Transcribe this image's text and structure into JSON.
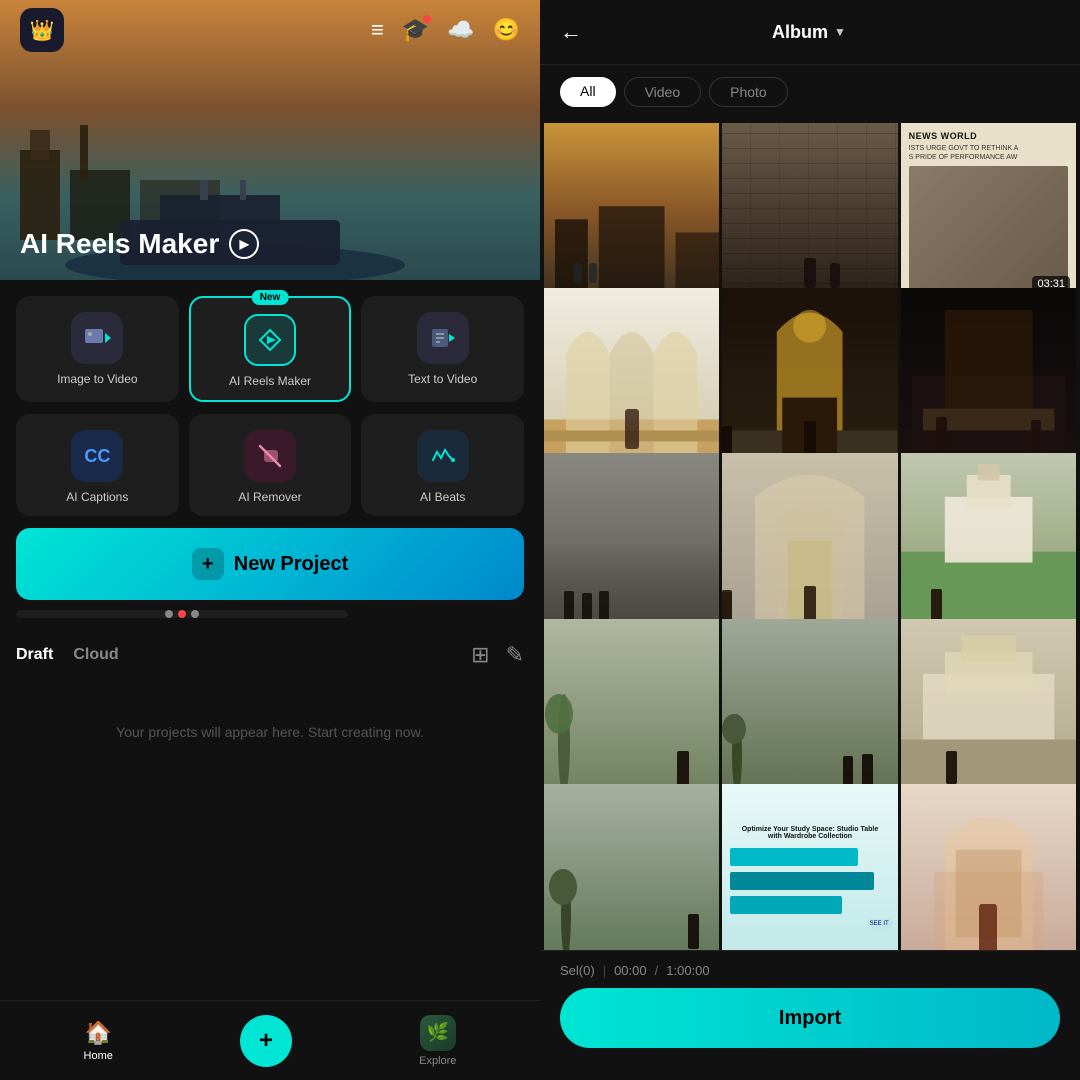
{
  "left": {
    "hero_title": "AI Reels Maker",
    "tools": [
      {
        "id": "image-to-video",
        "label": "Image to Video",
        "icon": "🎬",
        "iconClass": "tool-icon-img",
        "new": false,
        "active": false
      },
      {
        "id": "ai-reels-maker",
        "label": "AI Reels Maker",
        "icon": "⚡",
        "iconClass": "tool-icon-reels",
        "new": true,
        "active": true
      },
      {
        "id": "text-to-video",
        "label": "Text to Video",
        "icon": "✏️",
        "iconClass": "tool-icon-txt",
        "new": false,
        "active": false
      },
      {
        "id": "ai-captions",
        "label": "AI Captions",
        "icon": "CC",
        "iconClass": "tool-icon-cc",
        "new": false,
        "active": false
      },
      {
        "id": "ai-remover",
        "label": "AI Remover",
        "icon": "🧹",
        "iconClass": "tool-icon-remover",
        "new": false,
        "active": false
      },
      {
        "id": "ai-beats",
        "label": "AI Beats",
        "icon": "🎵",
        "iconClass": "tool-icon-beats",
        "new": false,
        "active": false
      }
    ],
    "new_project_label": "New Project",
    "new_badge_label": "New",
    "tabs": [
      "Draft",
      "Cloud"
    ],
    "active_tab": "Draft",
    "empty_state": "Your projects will appear here. Start creating now.",
    "nav": {
      "home_label": "Home",
      "explore_label": "Explore"
    }
  },
  "right": {
    "album_title": "Album",
    "filter_tabs": [
      "All",
      "Video",
      "Photo"
    ],
    "active_filter": "All",
    "photos": [
      {
        "id": 1,
        "scene": "street",
        "has_duration": false
      },
      {
        "id": 2,
        "scene": "people-dark",
        "has_duration": false
      },
      {
        "id": 3,
        "scene": "news",
        "has_duration": true,
        "duration": "03:31"
      },
      {
        "id": 4,
        "scene": "arch-white",
        "has_duration": false
      },
      {
        "id": 5,
        "scene": "arch-gold",
        "has_duration": false
      },
      {
        "id": 6,
        "scene": "arch-night",
        "has_duration": false
      },
      {
        "id": 7,
        "scene": "group1",
        "has_duration": false
      },
      {
        "id": 8,
        "scene": "group2",
        "has_duration": false
      },
      {
        "id": 9,
        "scene": "garden1",
        "has_duration": false
      },
      {
        "id": 10,
        "scene": "outdoor1",
        "has_duration": false
      },
      {
        "id": 11,
        "scene": "outdoor2",
        "has_duration": false
      },
      {
        "id": 12,
        "scene": "palace",
        "has_duration": false
      },
      {
        "id": 13,
        "scene": "outdoor3",
        "has_duration": false
      },
      {
        "id": 14,
        "scene": "shelf",
        "has_duration": false
      },
      {
        "id": 15,
        "scene": "arch-red",
        "has_duration": false
      }
    ],
    "sel_label": "Sel(0)",
    "time_current": "00:00",
    "time_limit": "1:00:00",
    "import_label": "Import"
  }
}
